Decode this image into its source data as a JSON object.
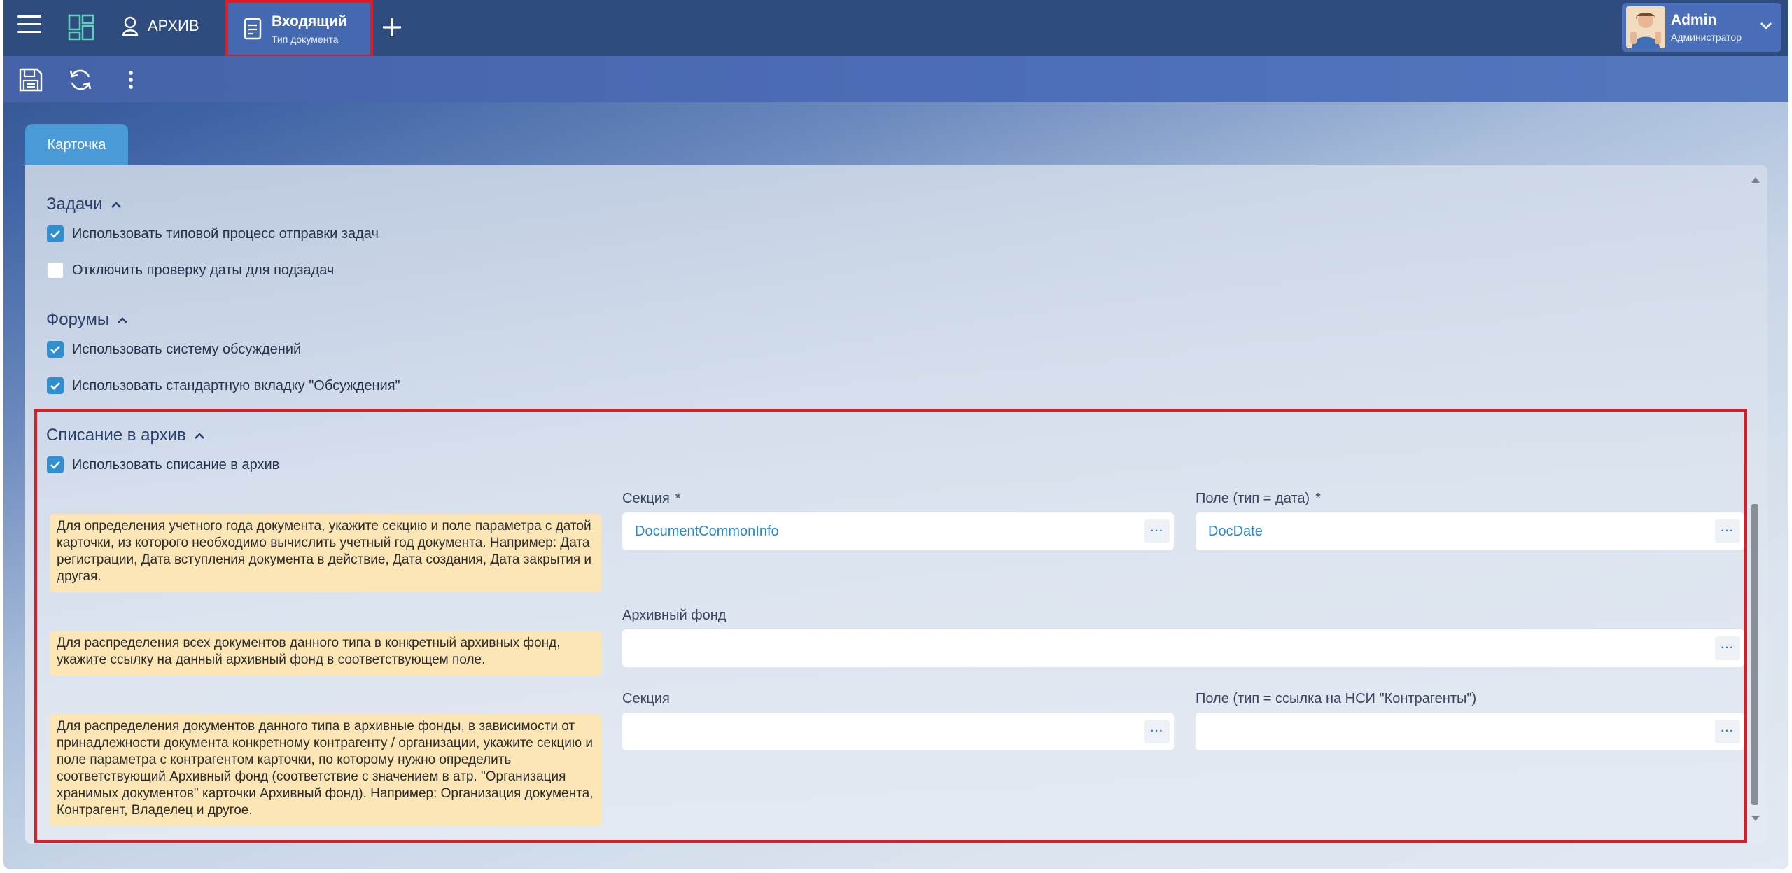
{
  "topbar": {
    "archive_label": "АРХИВ",
    "doc_tab": {
      "title": "Входящий",
      "subtitle": "Тип документа"
    },
    "user": {
      "name": "Admin",
      "role": "Администратор"
    }
  },
  "tabs": {
    "card_label": "Карточка"
  },
  "sections": {
    "tasks": {
      "title": "Задачи",
      "options": [
        {
          "label": "Использовать типовой процесс отправки задач",
          "checked": true
        },
        {
          "label": "Отключить проверку даты для подзадач",
          "checked": false
        }
      ]
    },
    "forums": {
      "title": "Форумы",
      "options": [
        {
          "label": "Использовать систему обсуждений",
          "checked": true
        },
        {
          "label": "Использовать стандартную вкладку \"Обсуждения\"",
          "checked": true
        }
      ]
    },
    "archive": {
      "title": "Списание в архив",
      "use_label": "Использовать списание в архив",
      "use_checked": true,
      "hint1": "Для определения учетного года документа, укажите секцию и поле параметра с датой карточки, из которого необходимо вычислить учетный год документа. Например: Дата регистрации, Дата вступления документа в действие, Дата создания, Дата закрытия и другая.",
      "hint2": "Для распределения всех документов данного типа в конкретный архивных фонд, укажите ссылку на данный архивный фонд в соответствующем поле.",
      "hint3": "Для распределения документов данного типа в архивные фонды, в зависимости от принадлежности документа конкретному контрагенту / организации, укажите секцию и поле параметра с контрагентом карточки, по которому нужно определить соответствующий Архивный фонд (соответствие с значением в атр. \"Организация хранимых документов\" карточки Архивный фонд). Например: Организация документа, Контрагент, Владелец и другое.",
      "section_label": "Секция",
      "date_field_label": "Поле (тип = дата)",
      "required_mark": "*",
      "section_value": "DocumentCommonInfo",
      "date_field_value": "DocDate",
      "fund_label": "Архивный фонд",
      "fund_value": "",
      "section2_label": "Секция",
      "section2_value": "",
      "contractor_field_label": "Поле (тип = ссылка на НСИ \"Контрагенты\")",
      "contractor_field_value": "",
      "ellipsis": "···"
    }
  },
  "colors": {
    "accent": "#2f8fd0",
    "highlight_border": "#e01b22",
    "hint_bg": "#fce6b5",
    "topbar": "#2e4c7e"
  }
}
